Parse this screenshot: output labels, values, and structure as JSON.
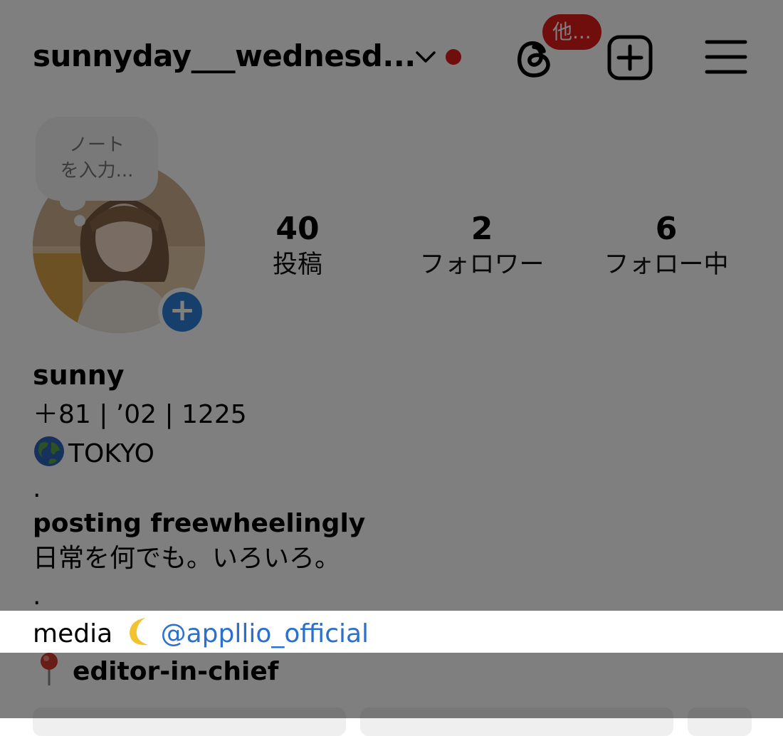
{
  "header": {
    "username": "sunnyday___wednesd...",
    "threads_badge": "他..."
  },
  "note": {
    "line1": "ノート",
    "line2": "を入力..."
  },
  "stats": [
    {
      "value": "40",
      "label": "投稿"
    },
    {
      "value": "2",
      "label": "フォロワー"
    },
    {
      "value": "6",
      "label": "フォロー中"
    }
  ],
  "bio": {
    "name": "sunny",
    "line1": "＋81 | ’02 | 1225",
    "location": "TOKYO",
    "dot1": ".",
    "headline": "posting freewheelingly",
    "jp": "日常を何でも。いろいろ。",
    "dot2": ".",
    "media_prefix": "media ",
    "media_mention": "@appllio_official",
    "role": "editor-in-chief"
  },
  "icons": {
    "chevron": "chevron-down-icon",
    "threads": "threads-icon",
    "new_post": "plus-square-icon",
    "menu": "hamburger-menu-icon",
    "add_story": "plus-circle-icon",
    "globe": "globe-emoji",
    "moon": "crescent-moon-emoji",
    "pin": "round-pushpin-emoji"
  },
  "colors": {
    "notification": "#e11b1b",
    "link": "#2b6fcf",
    "add_story": "#2f7fd8",
    "overlay": "rgba(0,0,0,0.5)"
  }
}
